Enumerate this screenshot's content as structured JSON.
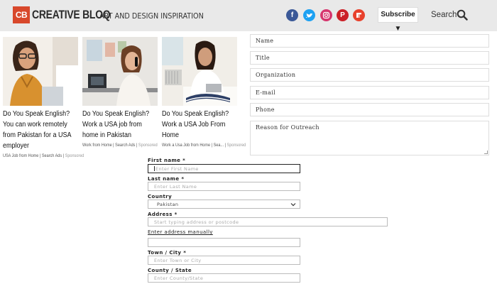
{
  "header": {
    "logo_mark": "CB",
    "logo_text": "CREATIVE BLOQ",
    "tagline": "ART AND DESIGN INSPIRATION",
    "social": [
      {
        "name": "facebook",
        "glyph": "f",
        "color": "#3b5998"
      },
      {
        "name": "twitter",
        "glyph": "t",
        "color": "#1da1f2"
      },
      {
        "name": "instagram",
        "glyph": "◎",
        "color": "#d6366e"
      },
      {
        "name": "pinterest",
        "glyph": "P",
        "color": "#cb2027"
      },
      {
        "name": "flipboard",
        "glyph": "f",
        "color": "#e8412c"
      }
    ],
    "subscribe_label": "Subscribe ▼",
    "search_label": "Search"
  },
  "articles": [
    {
      "title": "Do You Speak English? You can work remotely from Pakistan for a USA employer",
      "source": "USA Job from Home | Search Ads",
      "sponsored": "Sponsored",
      "image_icon": "woman-with-glasses-at-laptop"
    },
    {
      "title": "Do You Speak English? Work a USA job from home in Pakistan",
      "source": "Work from Home | Search Ads",
      "sponsored": "Sponsored",
      "image_icon": "woman-on-phone-at-desk"
    },
    {
      "title": "Do You Speak English? Work a USA Job From Home",
      "source": "Work a Usa Job from Home | Sea...",
      "sponsored": "Sponsored",
      "image_icon": "woman-on-bed-with-laptop"
    }
  ],
  "contact_form": {
    "name_placeholder": "Name",
    "title_placeholder": "Title",
    "organization_placeholder": "Organization",
    "email_placeholder": "E-mail",
    "phone_placeholder": "Phone",
    "reason_placeholder": "Reason for Outreach"
  },
  "address_form": {
    "first_name_label": "First name *",
    "first_name_placeholder": "Enter First Name",
    "last_name_label": "Last name *",
    "last_name_placeholder": "Enter Last Name",
    "country_label": "Country",
    "country_value": "Pakistan",
    "address_label": "Address *",
    "address_placeholder": "Start typing address or postcode",
    "manual_link": "Enter address manually",
    "town_label": "Town / City *",
    "town_placeholder": "Enter Town or City",
    "county_label": "County / State",
    "county_placeholder": "Enter County/State"
  }
}
